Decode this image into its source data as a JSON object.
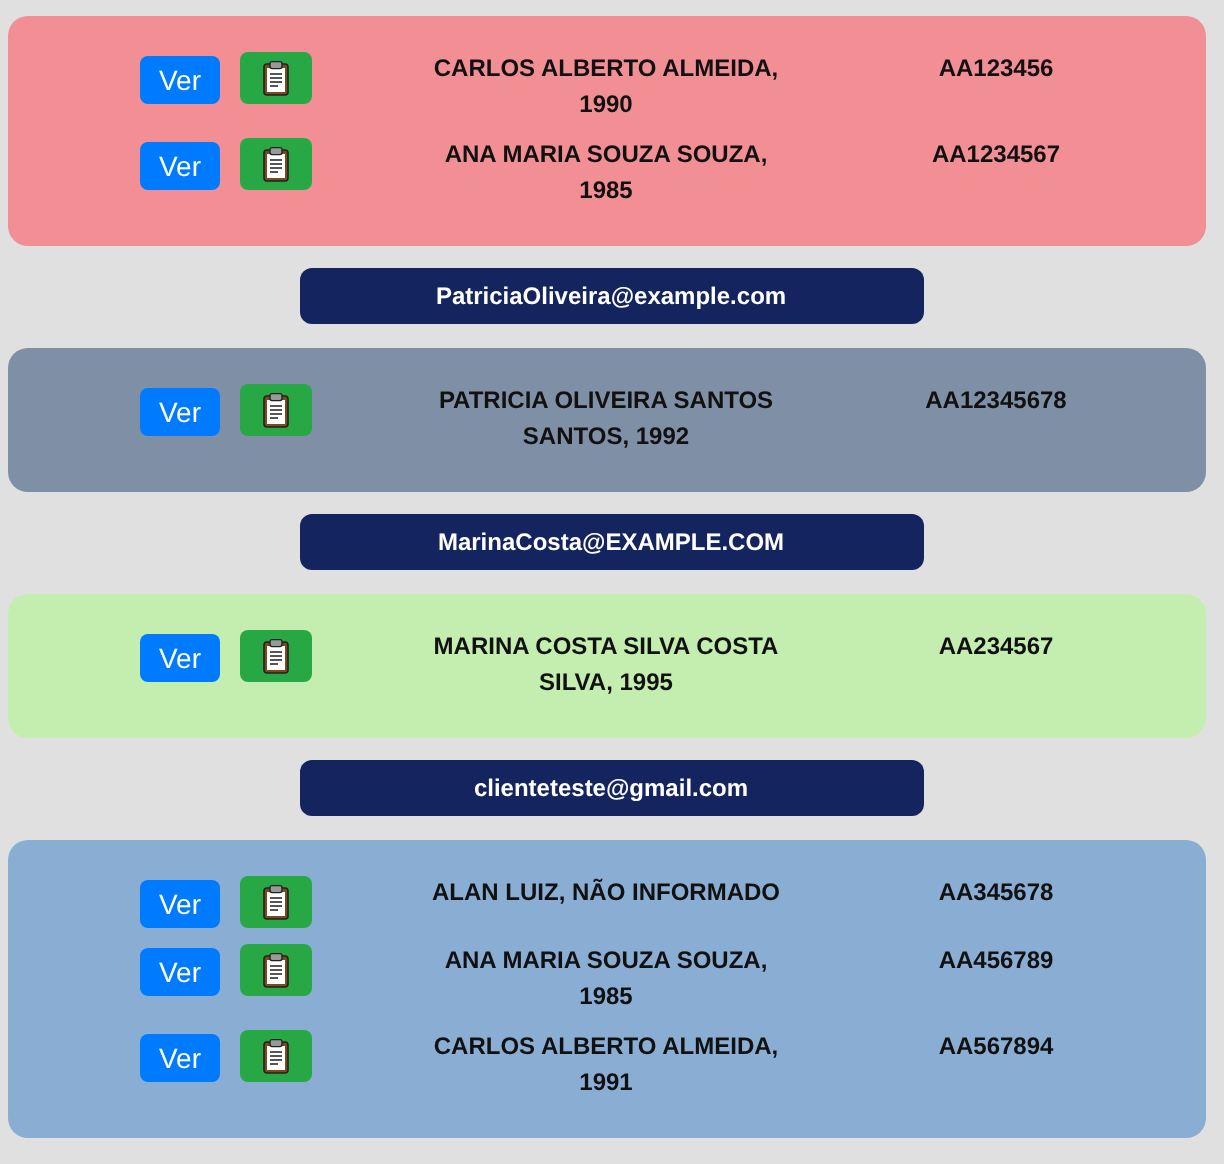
{
  "groups": [
    {
      "color": "#f28f94",
      "rows": [
        {
          "button": "Ver",
          "name": "CARLOS ALBERTO ALMEIDA, 1990",
          "code": "AA123456"
        },
        {
          "button": "Ver",
          "name": "ANA MARIA SOUZA SOUZA, 1985",
          "code": "AA1234567"
        }
      ]
    },
    {
      "email": "PatriciaOliveira@example.com",
      "color": "#7f8fa6",
      "rows": [
        {
          "button": "Ver",
          "name": "PATRICIA OLIVEIRA SANTOS SANTOS, 1992",
          "code": "AA12345678"
        }
      ]
    },
    {
      "email": "MarinaCosta@EXAMPLE.COM",
      "color": "#c3eeb0",
      "rows": [
        {
          "button": "Ver",
          "name": "MARINA COSTA SILVA COSTA SILVA, 1995",
          "code": "AA234567"
        }
      ]
    },
    {
      "email": "clienteteste@gmail.com",
      "color": "#8aaed3",
      "rows": [
        {
          "button": "Ver",
          "name": "ALAN LUIZ, NÃO INFORMADO",
          "code": "AA345678"
        },
        {
          "button": "Ver",
          "name": "ANA MARIA SOUZA SOUZA, 1985",
          "code": "AA456789"
        },
        {
          "button": "Ver",
          "name": "CARLOS ALBERTO ALMEIDA, 1991",
          "code": "AA567894"
        }
      ]
    }
  ]
}
